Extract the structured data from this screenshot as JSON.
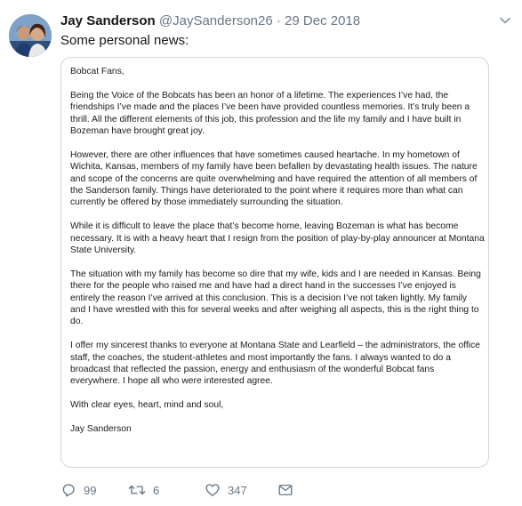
{
  "tweet": {
    "display_name": "Jay Sanderson",
    "handle": "@JaySanderson26",
    "separator": "·",
    "date": "29 Dec 2018",
    "text": "Some personal news:",
    "letter": {
      "salutation": "Bobcat Fans,",
      "paragraphs": [
        "Being the Voice of the Bobcats has been an honor of a lifetime.  The experiences I’ve had, the friendships I’ve made and the places I’ve been have provided countless memories.  It’s truly been a thrill.  All the different elements of this job, this profession and the life my family and I have built in Bozeman have brought great joy.",
        "However, there are other influences that have sometimes caused heartache.  In my hometown of Wichita, Kansas, members of my family have been befallen by devastating health issues.  The nature and scope of the concerns are quite overwhelming and have required the attention of all members of the Sanderson family.  Things have deteriorated to the point where it requires more than what can currently be offered by those immediately surrounding the situation.",
        "While it is difficult to leave the place that’s become home, leaving Bozeman is what has become necessary.  It is with a heavy heart that I resign from the position of play-by-play announcer at Montana State University.",
        "The situation with my family has become so dire that my wife, kids and I are needed in Kansas.  Being there for the people who raised me and have had a direct hand in the successes I’ve enjoyed is entirely the reason I’ve arrived at this conclusion.  This is a decision I’ve not taken lightly.  My family and I have wrestled with this for several weeks and after weighing all aspects, this is the right thing to do.",
        "I offer my sincerest thanks to everyone at Montana State and Learfield – the administrators, the office staff, the coaches, the student-athletes and most importantly the fans.  I always wanted to do a broadcast that reflected the passion, energy and enthusiasm of the wonderful Bobcat fans everywhere.  I hope all who were interested agree.",
        "With clear eyes, heart, mind and soul,"
      ],
      "signature": "Jay Sanderson"
    },
    "actions": {
      "replies": "99",
      "retweets": "6",
      "likes": "347"
    }
  },
  "colors": {
    "text": "#14171a",
    "secondary": "#657786",
    "border": "#ccd6dd"
  },
  "icons": [
    "reply-icon",
    "retweet-icon",
    "like-icon",
    "direct-message-icon",
    "caret-down-icon"
  ]
}
